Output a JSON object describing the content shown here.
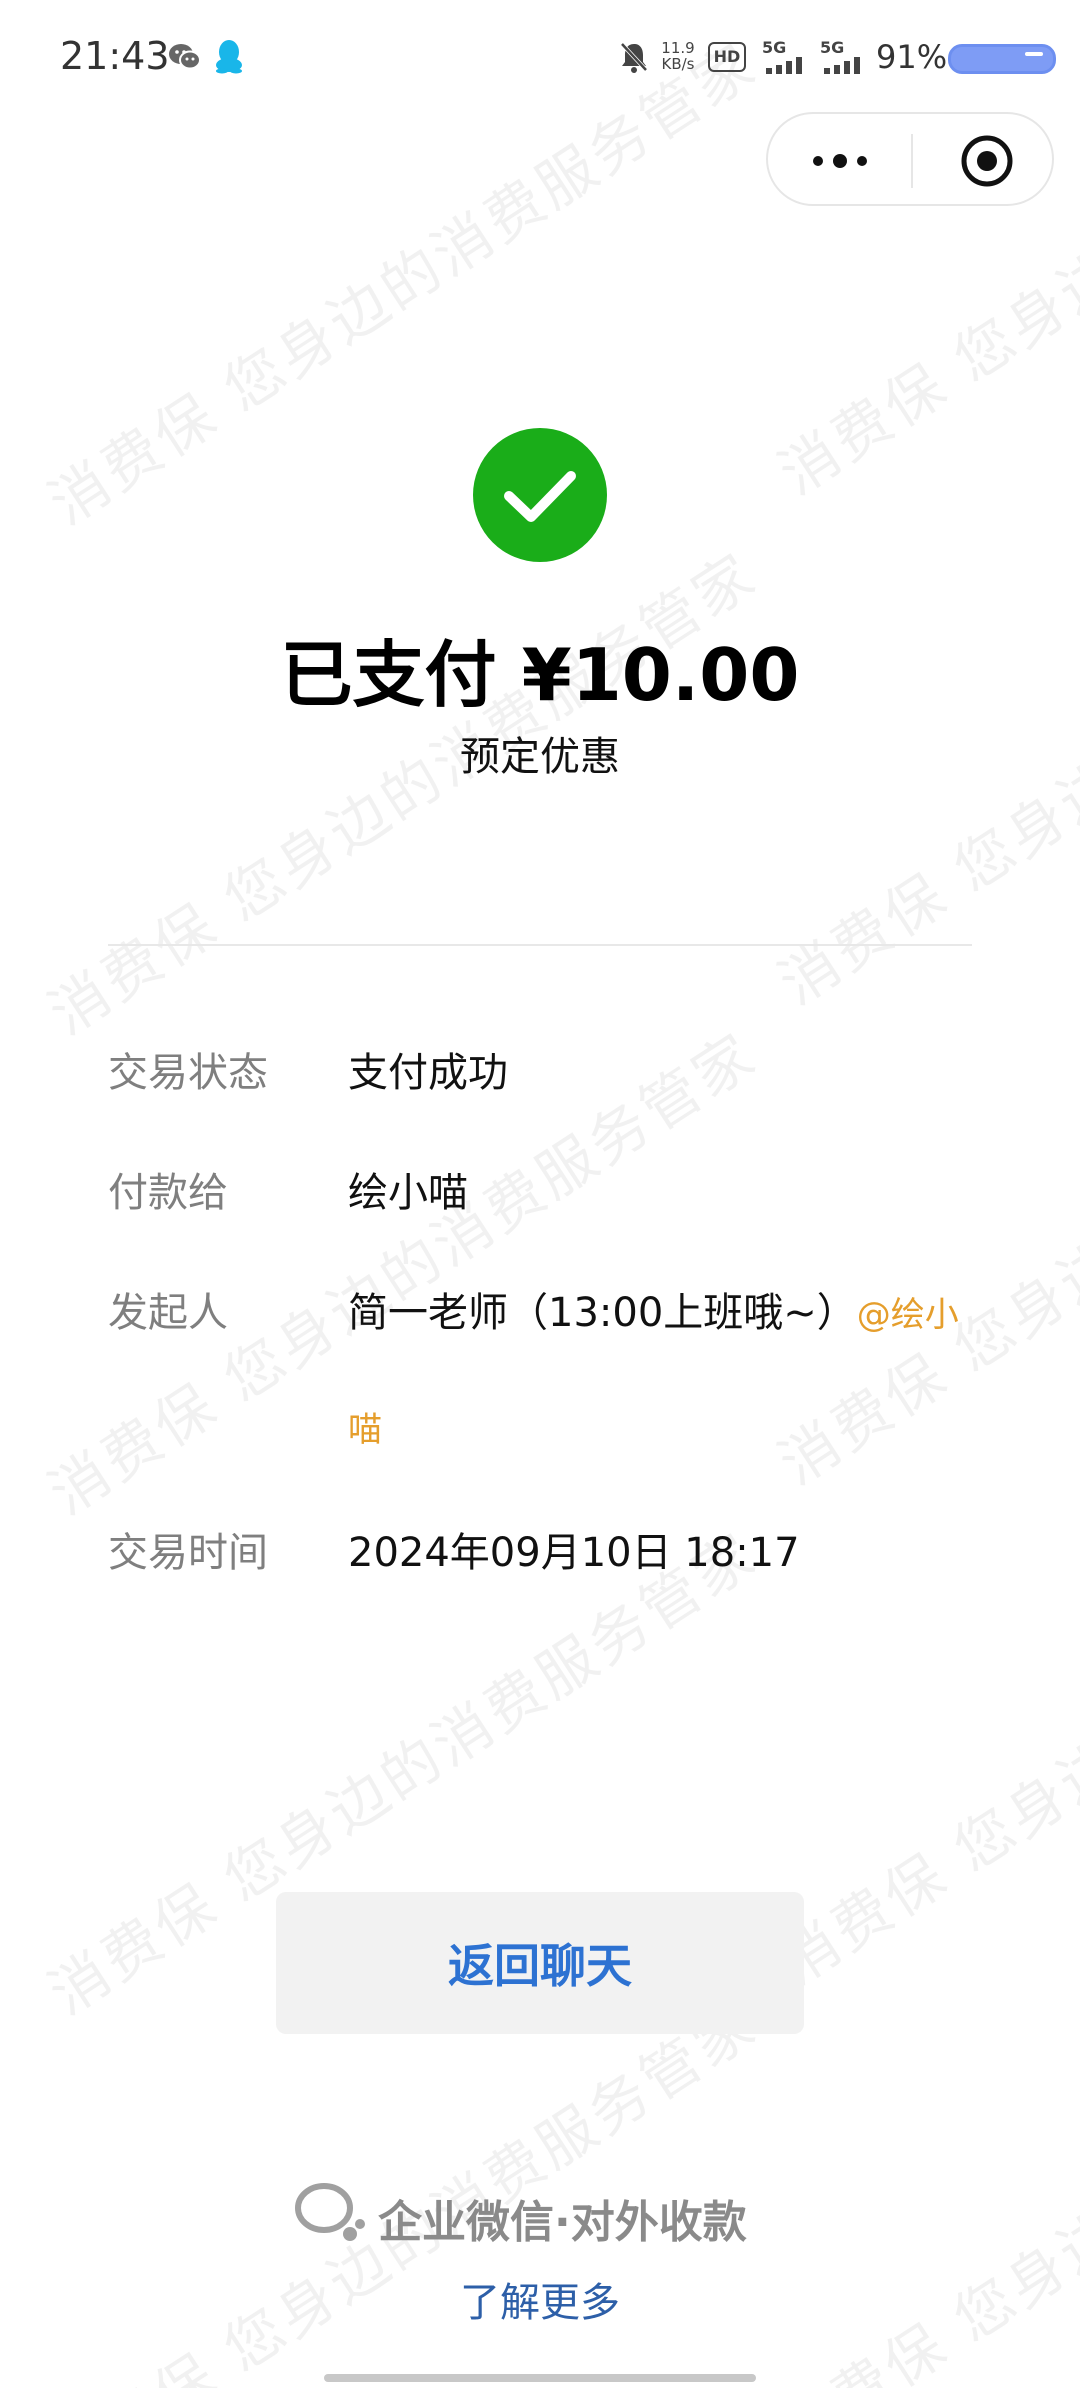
{
  "status_bar": {
    "time": "21:43",
    "net_speed_value": "11.9",
    "net_speed_unit": "KB/s",
    "hd_label": "HD",
    "sim1_tag": "5G",
    "sim2_tag": "5G",
    "battery_percent": "91%"
  },
  "payment": {
    "title": "已支付 ¥10.00",
    "subtitle": "预定优惠"
  },
  "details": {
    "rows": [
      {
        "label": "交易状态",
        "value": "支付成功"
      },
      {
        "label": "付款给",
        "value": "绘小喵"
      },
      {
        "label": "发起人",
        "value_line1": "简一老师（13:00上班哦~）",
        "mention_line1": "@绘小",
        "mention_line2": "喵"
      },
      {
        "label": "交易时间",
        "value": "2024年09月10日 18:17"
      }
    ]
  },
  "actions": {
    "back_label": "返回聊天"
  },
  "footer": {
    "brand": "企业微信·对外收款",
    "learn_more": "了解更多"
  },
  "watermark": {
    "text": "消费保 您身边的消费服务管家"
  },
  "colors": {
    "success_green": "#1aad19",
    "link_blue": "#2d72d2",
    "mention_orange": "#e59e2c",
    "label_gray": "#7f7f7f"
  }
}
